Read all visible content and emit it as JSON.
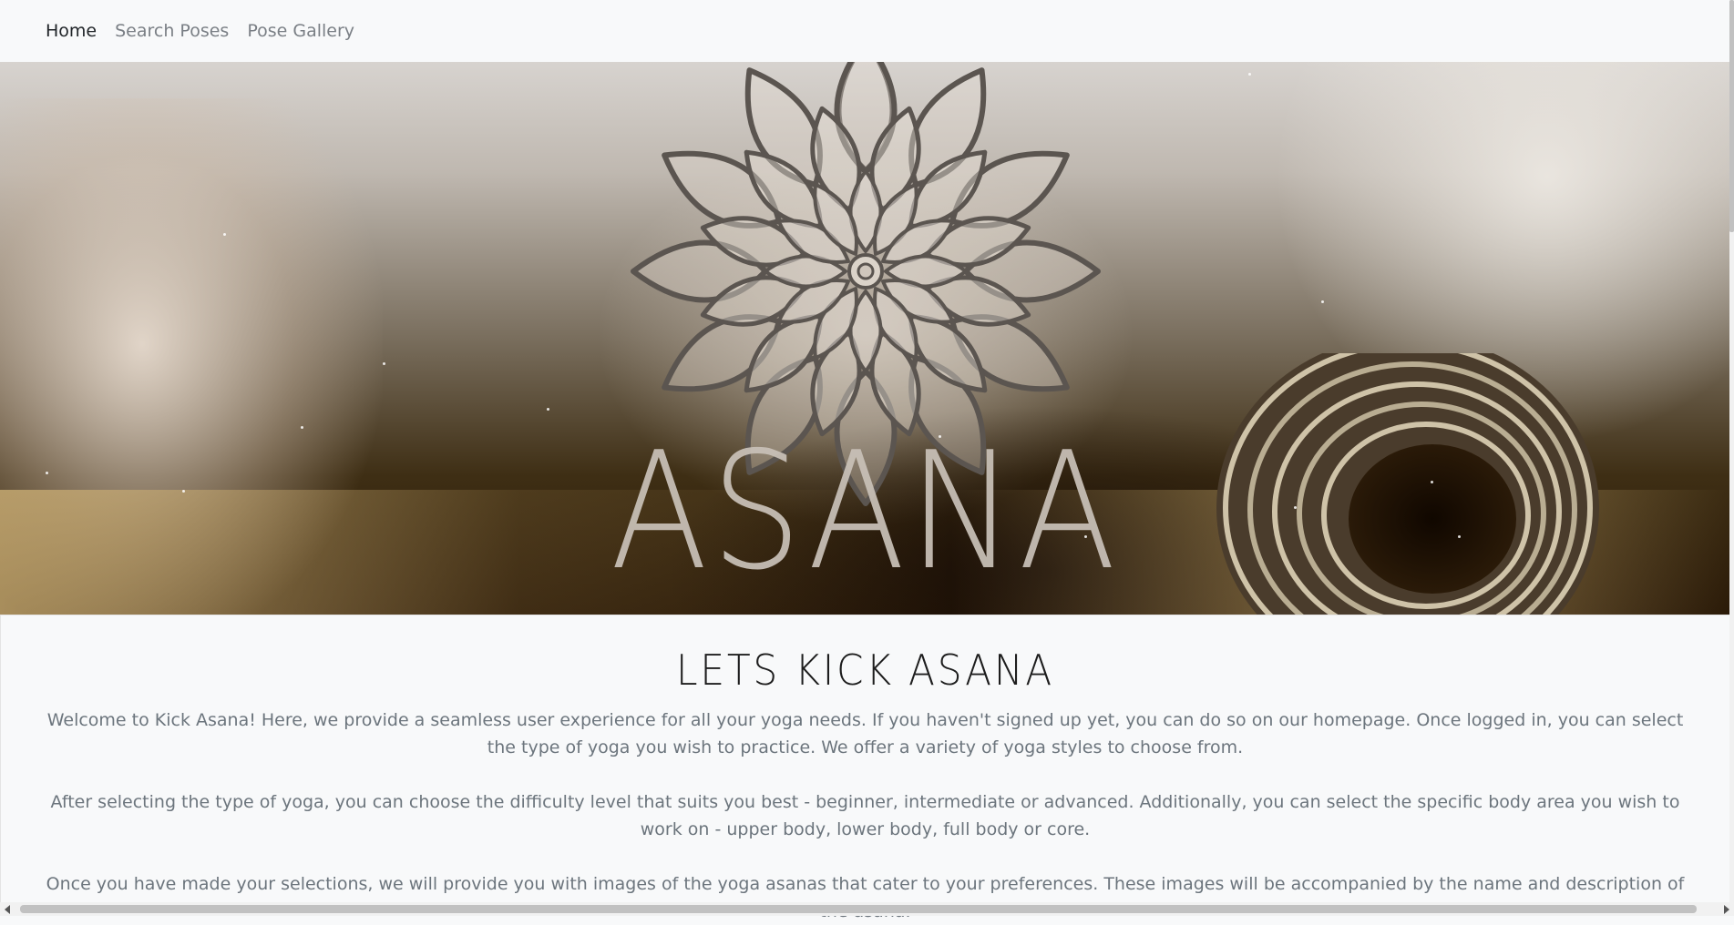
{
  "nav": {
    "items": [
      {
        "label": "Home",
        "active": true
      },
      {
        "label": "Search Poses",
        "active": false
      },
      {
        "label": "Pose Gallery",
        "active": false
      }
    ]
  },
  "hero": {
    "word": "ASANA",
    "logo_icon": "mandala-icon"
  },
  "content": {
    "heading": "LETS KICK ASANA",
    "paragraphs": [
      "Welcome to Kick Asana! Here, we provide a seamless user experience for all your yoga needs. If you haven't signed up yet, you can do so on our homepage. Once logged in, you can select the type of yoga you wish to practice. We offer a variety of yoga styles to choose from.",
      "After selecting the type of yoga, you can choose the difficulty level that suits you best - beginner, intermediate or advanced. Additionally, you can select the specific body area you wish to work on - upper body, lower body, full body or core.",
      "Once you have made your selections, we will provide you with images of the yoga asanas that cater to your preferences. These images will be accompanied by the name and description of the asana."
    ]
  },
  "colors": {
    "page_background": "#f8f9fa",
    "nav_active": "#212529",
    "nav_inactive": "#7a7f85",
    "paragraph_text": "#6c757d"
  }
}
